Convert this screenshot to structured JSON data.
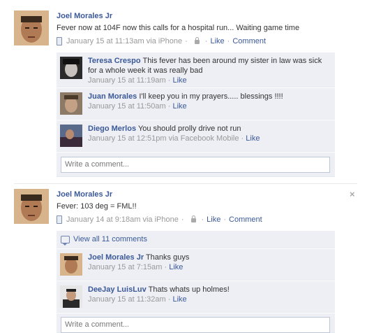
{
  "posts": [
    {
      "author": "Joel Morales Jr",
      "text": "Fever now at 104F now this calls for a hospital run... Waiting game time",
      "meta": {
        "time": "January 15 at 11:13am via iPhone",
        "like": "Like",
        "comment": "Comment"
      },
      "comments": [
        {
          "name": "Teresa Crespo",
          "text": "This fever has been around my sister in law was sick for a whole week it was really bad",
          "time": "January 15 at 11:19am",
          "like": "Like"
        },
        {
          "name": "Juan Morales",
          "text": "I'll keep you in my prayers..... blessings !!!!",
          "time": "January 15 at 11:50am",
          "like": "Like"
        },
        {
          "name": "Diego Merlos",
          "text": "You should prolly drive not run",
          "time": "January 15 at 12:51pm via Facebook Mobile",
          "like": "Like"
        }
      ],
      "comment_placeholder": "Write a comment..."
    },
    {
      "author": "Joel Morales Jr",
      "text": "Fever: 103 deg = FML!!",
      "meta": {
        "time": "January 14 at 9:18am via iPhone",
        "like": "Like",
        "comment": "Comment"
      },
      "view_all": "View all 11 comments",
      "comments": [
        {
          "name": "Joel Morales Jr",
          "text": "Thanks guys",
          "time": "January 15 at 7:15am",
          "like": "Like"
        },
        {
          "name": "DeeJay LuisLuv",
          "text": "Thats whats up holmes!",
          "time": "January 15 at 11:32am",
          "like": "Like"
        }
      ],
      "comment_placeholder": "Write a comment..."
    }
  ],
  "separator": "·",
  "close_glyph": "×",
  "colors": {
    "link": "#3b5998",
    "ufi_bg": "#edeff4",
    "meta": "#999999"
  },
  "icons": [
    "phone-icon",
    "lock-icon",
    "comment-bubble-icon",
    "close-icon"
  ]
}
